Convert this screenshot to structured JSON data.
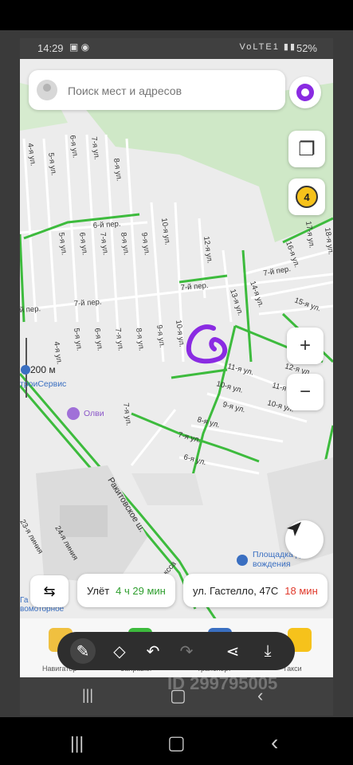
{
  "status_bar": {
    "time": "14:29",
    "signal_text": "VoLTE1",
    "battery": "52%"
  },
  "search": {
    "placeholder": "Поиск мест и адресов"
  },
  "traffic": {
    "level": "4"
  },
  "map": {
    "streets": [
      "4-я ул.",
      "5-я ул.",
      "6-я ул.",
      "7-я ул.",
      "8-я ул.",
      "6-й пер.",
      "10-я ул.",
      "12-я ул.",
      "17-я ул.",
      "18-я ул.",
      "5-я ул.",
      "6-я ул.",
      "7-я ул.",
      "8-я ул.",
      "9-я ул.",
      "7-й пер.",
      "7-й пер.",
      "14-я ул.",
      "16-я ул.",
      "13-я ул.",
      "15-я ул.",
      "7-й пер.",
      "й пер.",
      "4-я ул.",
      "5-я ул.",
      "6-я ул.",
      "7-я ул.",
      "8-я ул.",
      "9-я ул.",
      "10-я ул.",
      "12-я ул.",
      "11-я ул.",
      "11-я ул.",
      "10-я ул.",
      "10-я ул.",
      "9-я ул.",
      "8-я ул.",
      "7-я ул.",
      "6-я ул.",
      "7-я ул.",
      "Ракитовское ш.",
      "23-я линия",
      "24-я линия",
      "ксса"
    ],
    "scale": "200 м",
    "poi_1": "троиСервис",
    "poi_2": "Олви",
    "poi_3_line1": "Площадка для",
    "poi_3_line2": "вождения",
    "poi_4_line1": "Га",
    "poi_4_line2": "вомоторное"
  },
  "chips": {
    "airport_label": "Улёт",
    "airport_time": "4 ч 29 мин",
    "address_label": "ул. Гастелло, 47С",
    "address_time": "18 мин"
  },
  "tabs": [
    {
      "label": "Навигатор"
    },
    {
      "label": "Заправки"
    },
    {
      "label": "Транспорт"
    },
    {
      "label": "Такси"
    }
  ],
  "watermark": "ID 299795005",
  "colors": {
    "accent_purple": "#8a2be2",
    "green_route": "#3dbb3d",
    "traffic_yellow": "#f6c21b"
  }
}
